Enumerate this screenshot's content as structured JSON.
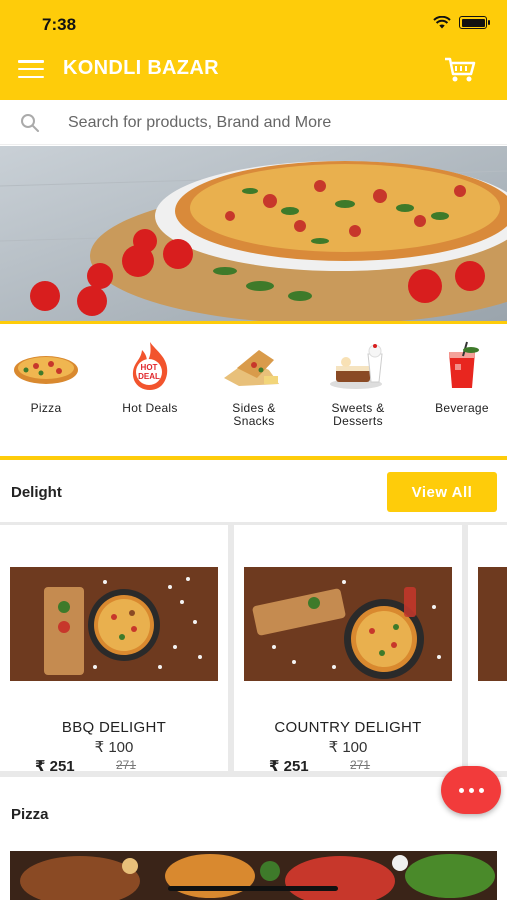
{
  "status_bar": {
    "time": "7:38"
  },
  "header": {
    "title": "KONDLI BAZAR",
    "menu_icon": "hamburger-menu-icon",
    "cart_icon": "shopping-cart-icon"
  },
  "search": {
    "placeholder": "Search for products, Brand and More",
    "value": ""
  },
  "banner": {
    "image": "pizza-banner"
  },
  "categories": [
    {
      "label": "Pizza",
      "icon": "pizza-icon"
    },
    {
      "label": "Hot Deals",
      "icon": "hot-deal-icon",
      "badge_line1": "HOT",
      "badge_line2": "DEAL"
    },
    {
      "label": "Sides &\nSnacks",
      "icon": "sides-snacks-icon"
    },
    {
      "label": "Sweets &\nDesserts",
      "icon": "sweets-desserts-icon"
    },
    {
      "label": "Beverage",
      "icon": "beverage-icon"
    }
  ],
  "sections": [
    {
      "title": "Delight",
      "view_all_label": "View All",
      "products": [
        {
          "name": "BBQ DELIGHT",
          "price": "₹ 100",
          "sale_price": "₹ 251",
          "mrp": "271"
        },
        {
          "name": "COUNTRY DELIGHT",
          "price": "₹ 100",
          "sale_price": "₹ 251",
          "mrp": "271"
        }
      ]
    },
    {
      "title": "Pizza"
    }
  ],
  "colors": {
    "brand_yellow": "#FECC0A",
    "fab_red": "#F23B3B"
  }
}
